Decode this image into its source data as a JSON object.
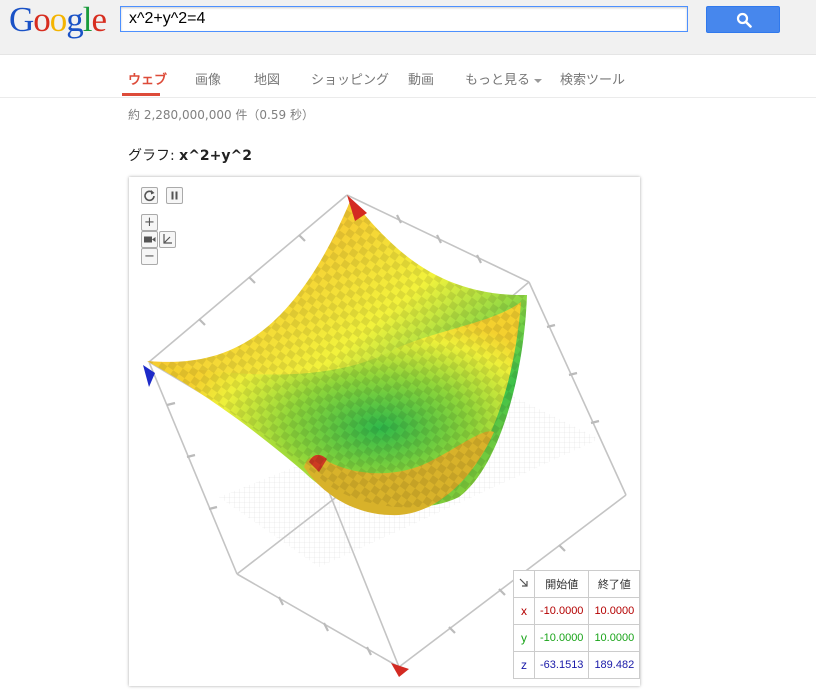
{
  "header": {
    "logo": [
      "G",
      "o",
      "o",
      "g",
      "l",
      "e"
    ],
    "logo_colors": [
      "#1a52c6",
      "#d72d1f",
      "#f4b400",
      "#1a52c6",
      "#1a9b3c",
      "#d72d1f"
    ],
    "search_value": "x^2+y^2=4"
  },
  "nav": {
    "items": [
      "ウェブ",
      "画像",
      "地図",
      "ショッピング",
      "動画",
      "もっと見る",
      "検索ツール"
    ]
  },
  "results": {
    "stats": "約 2,280,000,000 件（0.59 秒）"
  },
  "graph": {
    "title_prefix": "グラフ: ",
    "title_expr": "x^2+y^2",
    "controls": {
      "reset": "C",
      "pause": "II",
      "zoom_in": "+",
      "zoom_out": "−"
    },
    "table": {
      "head_start": "開始値",
      "head_end": "終了値",
      "rows": [
        {
          "axis": "x",
          "start": "-10.0000",
          "end": "10.0000"
        },
        {
          "axis": "y",
          "start": "-10.0000",
          "end": "10.0000"
        },
        {
          "axis": "z",
          "start": "-63.1513",
          "end": "189.482"
        }
      ]
    }
  },
  "colors": {
    "accent_red": "#dd4b39",
    "button_blue": "#4787ed"
  }
}
